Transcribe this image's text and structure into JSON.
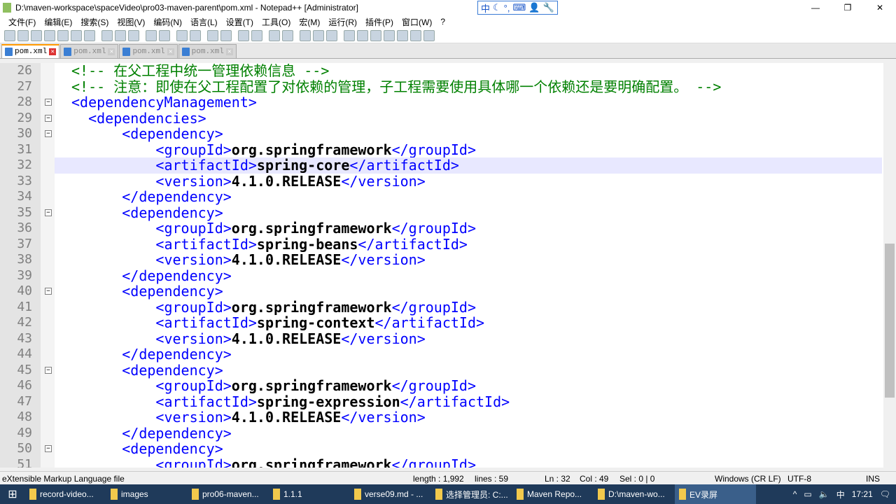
{
  "window": {
    "title": "D:\\maven-workspace\\spaceVideo\\pro03-maven-parent\\pom.xml - Notepad++ [Administrator]"
  },
  "ime": [
    "中",
    "☾",
    "°,",
    "⌨",
    "👤",
    "🔧"
  ],
  "menu": [
    "文件(F)",
    "编辑(E)",
    "搜索(S)",
    "视图(V)",
    "编码(N)",
    "语言(L)",
    "设置(T)",
    "工具(O)",
    "宏(M)",
    "运行(R)",
    "插件(P)",
    "窗口(W)",
    "?"
  ],
  "tabs": [
    {
      "label": "pom.xml",
      "active": true
    },
    {
      "label": "pom.xml"
    },
    {
      "label": "pom.xml"
    },
    {
      "label": "pom.xml"
    }
  ],
  "editor": {
    "current_line": 32,
    "lines": [
      {
        "n": 26,
        "ind": 0,
        "p": [
          [
            "cmt",
            "<!-- 在父工程中统一管理依赖信息 -->"
          ]
        ]
      },
      {
        "n": 27,
        "ind": 0,
        "p": [
          [
            "cmt",
            "<!-- 注意：即使在父工程配置了对依赖的管理，子工程需要使用具体哪一个依赖还是要明确配置。 -->"
          ]
        ]
      },
      {
        "n": 28,
        "ind": 0,
        "fold": "-",
        "p": [
          [
            "tag",
            "<dependencyManagement>"
          ]
        ]
      },
      {
        "n": 29,
        "ind": 2,
        "fold": "-",
        "p": [
          [
            "tag",
            "<dependencies>"
          ]
        ]
      },
      {
        "n": 30,
        "ind": 6,
        "fold": "-",
        "p": [
          [
            "tag",
            "<dependency>"
          ]
        ]
      },
      {
        "n": 31,
        "ind": 10,
        "p": [
          [
            "tag",
            "<groupId>"
          ],
          [
            "txt",
            "org.springframework"
          ],
          [
            "tag",
            "</groupId>"
          ]
        ]
      },
      {
        "n": 32,
        "ind": 10,
        "p": [
          [
            "tag",
            "<artifactId>"
          ],
          [
            "txt",
            "spring-core"
          ],
          [
            "tag",
            "</artifactId>"
          ]
        ]
      },
      {
        "n": 33,
        "ind": 10,
        "p": [
          [
            "tag",
            "<version>"
          ],
          [
            "txt",
            "4.1.0.RELEASE"
          ],
          [
            "tag",
            "</version>"
          ]
        ]
      },
      {
        "n": 34,
        "ind": 6,
        "p": [
          [
            "tag",
            "</dependency>"
          ]
        ]
      },
      {
        "n": 35,
        "ind": 6,
        "fold": "-",
        "p": [
          [
            "tag",
            "<dependency>"
          ]
        ]
      },
      {
        "n": 36,
        "ind": 10,
        "p": [
          [
            "tag",
            "<groupId>"
          ],
          [
            "txt",
            "org.springframework"
          ],
          [
            "tag",
            "</groupId>"
          ]
        ]
      },
      {
        "n": 37,
        "ind": 10,
        "p": [
          [
            "tag",
            "<artifactId>"
          ],
          [
            "txt",
            "spring-beans"
          ],
          [
            "tag",
            "</artifactId>"
          ]
        ]
      },
      {
        "n": 38,
        "ind": 10,
        "p": [
          [
            "tag",
            "<version>"
          ],
          [
            "txt",
            "4.1.0.RELEASE"
          ],
          [
            "tag",
            "</version>"
          ]
        ]
      },
      {
        "n": 39,
        "ind": 6,
        "p": [
          [
            "tag",
            "</dependency>"
          ]
        ]
      },
      {
        "n": 40,
        "ind": 6,
        "fold": "-",
        "p": [
          [
            "tag",
            "<dependency>"
          ]
        ]
      },
      {
        "n": 41,
        "ind": 10,
        "p": [
          [
            "tag",
            "<groupId>"
          ],
          [
            "txt",
            "org.springframework"
          ],
          [
            "tag",
            "</groupId>"
          ]
        ]
      },
      {
        "n": 42,
        "ind": 10,
        "p": [
          [
            "tag",
            "<artifactId>"
          ],
          [
            "txt",
            "spring-context"
          ],
          [
            "tag",
            "</artifactId>"
          ]
        ]
      },
      {
        "n": 43,
        "ind": 10,
        "p": [
          [
            "tag",
            "<version>"
          ],
          [
            "txt",
            "4.1.0.RELEASE"
          ],
          [
            "tag",
            "</version>"
          ]
        ]
      },
      {
        "n": 44,
        "ind": 6,
        "p": [
          [
            "tag",
            "</dependency>"
          ]
        ]
      },
      {
        "n": 45,
        "ind": 6,
        "fold": "-",
        "p": [
          [
            "tag",
            "<dependency>"
          ]
        ]
      },
      {
        "n": 46,
        "ind": 10,
        "p": [
          [
            "tag",
            "<groupId>"
          ],
          [
            "txt",
            "org.springframework"
          ],
          [
            "tag",
            "</groupId>"
          ]
        ]
      },
      {
        "n": 47,
        "ind": 10,
        "p": [
          [
            "tag",
            "<artifactId>"
          ],
          [
            "txt",
            "spring-expression"
          ],
          [
            "tag",
            "</artifactId>"
          ]
        ]
      },
      {
        "n": 48,
        "ind": 10,
        "p": [
          [
            "tag",
            "<version>"
          ],
          [
            "txt",
            "4.1.0.RELEASE"
          ],
          [
            "tag",
            "</version>"
          ]
        ]
      },
      {
        "n": 49,
        "ind": 6,
        "p": [
          [
            "tag",
            "</dependency>"
          ]
        ]
      },
      {
        "n": 50,
        "ind": 6,
        "fold": "-",
        "p": [
          [
            "tag",
            "<dependency>"
          ]
        ]
      },
      {
        "n": 51,
        "ind": 10,
        "p": [
          [
            "tag",
            "<groupId>"
          ],
          [
            "txt",
            "org.springframework"
          ],
          [
            "tag",
            "</groupId>"
          ]
        ]
      }
    ]
  },
  "status": {
    "filetype": "eXtensible Markup Language file",
    "length": "length : 1,992",
    "lines": "lines : 59",
    "ln": "Ln : 32",
    "col": "Col : 49",
    "sel": "Sel : 0 | 0",
    "eol": "Windows (CR LF)",
    "encoding": "UTF-8",
    "mode": "INS"
  },
  "taskbar": {
    "items": [
      "record-video...",
      "images",
      "pro06-maven...",
      "1.1.1",
      "verse09.md - ...",
      "选择管理员: C:...",
      "Maven Repo...",
      "D:\\maven-wo...",
      "EV录屏"
    ],
    "active": 8,
    "ime": "中",
    "time": "17:21"
  }
}
